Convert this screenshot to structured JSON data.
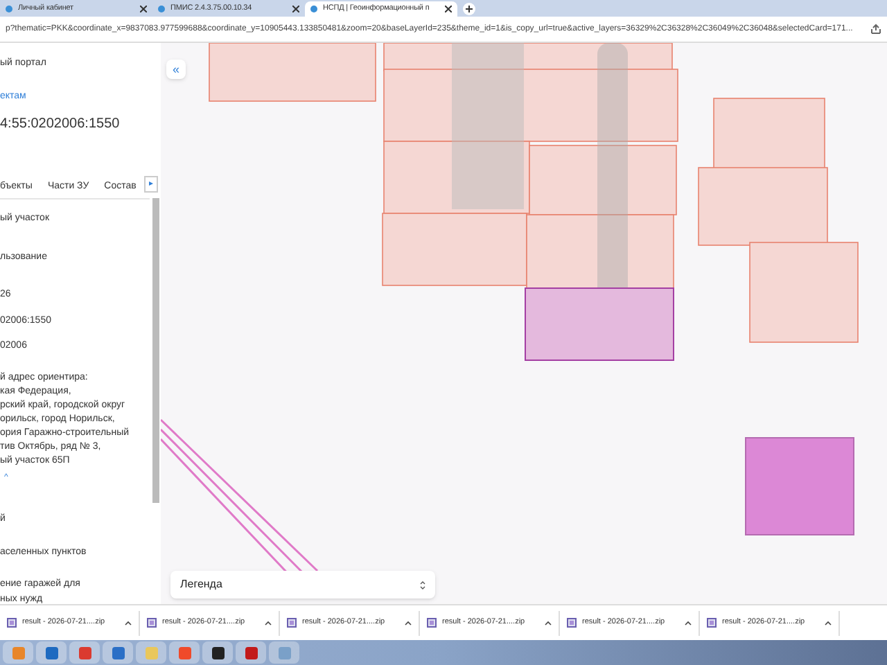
{
  "browser_tabs": [
    {
      "title": "Личный кабинет",
      "selected": false
    },
    {
      "title": "ПМИС 2.4.3.75.00.10.34",
      "selected": false
    },
    {
      "title": "НСПД | Геоинформационный п",
      "selected": true
    }
  ],
  "address_bar": {
    "url": "p?thematic=PKK&coordinate_x=9837083.977599688&coordinate_y=10905443.133850481&zoom=20&baseLayerId=235&theme_id=1&is_copy_url=true&active_layers=36329%2C36328%2C36049%2C36048&selectedCard=171..."
  },
  "panel": {
    "portal_title": "ый портал",
    "back_link": "ектам",
    "cadastral_number": "4:55:0202006:1550",
    "tabs": [
      {
        "label": "бъекты",
        "selected": false
      },
      {
        "label": "Части ЗУ",
        "selected": false
      },
      {
        "label": "Состав",
        "selected": false
      }
    ],
    "tabs_more": "▸",
    "fields": [
      "ый участок",
      "льзование",
      "26",
      "02006:1550",
      "02006"
    ],
    "address": "й адрес ориентира:\nкая Федерация,\nрский край, городской округ\nорильск, город Норильск,\nория Гаражно-строительный\nтив Октябрь, ряд № 3,\nый участок 65П",
    "collapse_chevron": "^",
    "fields_2": [
      "й",
      "аселенных пунктов",
      "ение гаражей для\nных нужд"
    ]
  },
  "map": {
    "collapse_button": "«",
    "legend": {
      "label": "Легенда"
    }
  },
  "downloads": [
    {
      "name": "result - 2026-07-21....zip"
    },
    {
      "name": "result - 2026-07-21....zip"
    },
    {
      "name": "result - 2026-07-21....zip"
    },
    {
      "name": "result - 2026-07-21....zip"
    },
    {
      "name": "result - 2026-07-21....zip"
    },
    {
      "name": "result - 2026-07-21....zip"
    }
  ]
}
